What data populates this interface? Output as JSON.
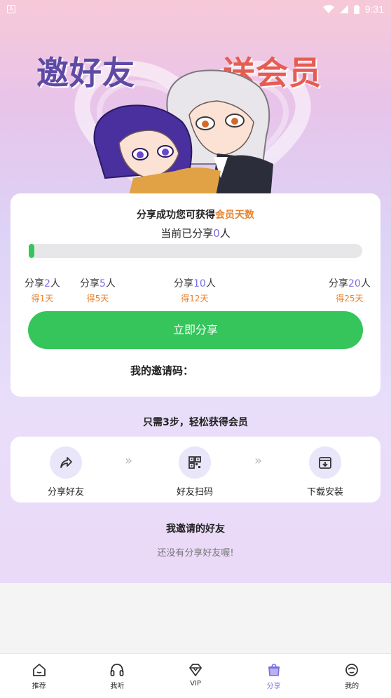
{
  "status_bar": {
    "time": "9:31",
    "app_icon_letter": "A"
  },
  "banner": {
    "title_left": "邀好友",
    "title_right": "送会员"
  },
  "share_card": {
    "tip_prefix": "分享成功您可获得",
    "tip_accent": "会员天数",
    "count_prefix": "当前已分享",
    "count_value": "0",
    "count_suffix": "人",
    "progress_fraction": 0.0,
    "milestones": [
      {
        "label_prefix": "分享",
        "num": "2",
        "label_suffix": "人",
        "reward": "得1天"
      },
      {
        "label_prefix": "分享",
        "num": "5",
        "label_suffix": "人",
        "reward": "得5天"
      },
      {
        "label_prefix": "分享",
        "num": "10",
        "label_suffix": "人",
        "reward": "得12天"
      },
      {
        "label_prefix": "分享",
        "num": "20",
        "label_suffix": "人",
        "reward": "得25天"
      }
    ],
    "share_button_label": "立即分享",
    "invite_code_label": "我的邀请码："
  },
  "steps": {
    "heading": "只需3步，轻松获得会员",
    "items": [
      {
        "label": "分享好友",
        "icon": "share-arrow-icon"
      },
      {
        "label": "好友扫码",
        "icon": "qr-code-icon"
      },
      {
        "label": "下载安装",
        "icon": "download-icon"
      }
    ],
    "arrow_glyph": "»"
  },
  "friends": {
    "heading": "我邀请的好友",
    "empty_text": "还没有分享好友喔!"
  },
  "tabbar": {
    "items": [
      {
        "label": "推荐",
        "icon": "home-icon"
      },
      {
        "label": "我听",
        "icon": "headphones-icon"
      },
      {
        "label": "VIP",
        "icon": "diamond-icon"
      },
      {
        "label": "分享",
        "icon": "gift-bag-icon"
      },
      {
        "label": "我的",
        "icon": "profile-icon"
      }
    ],
    "active_index": 3
  },
  "colors": {
    "accent_green": "#35c55a",
    "accent_orange": "#e8832f",
    "accent_purple": "#7a6fe0"
  }
}
